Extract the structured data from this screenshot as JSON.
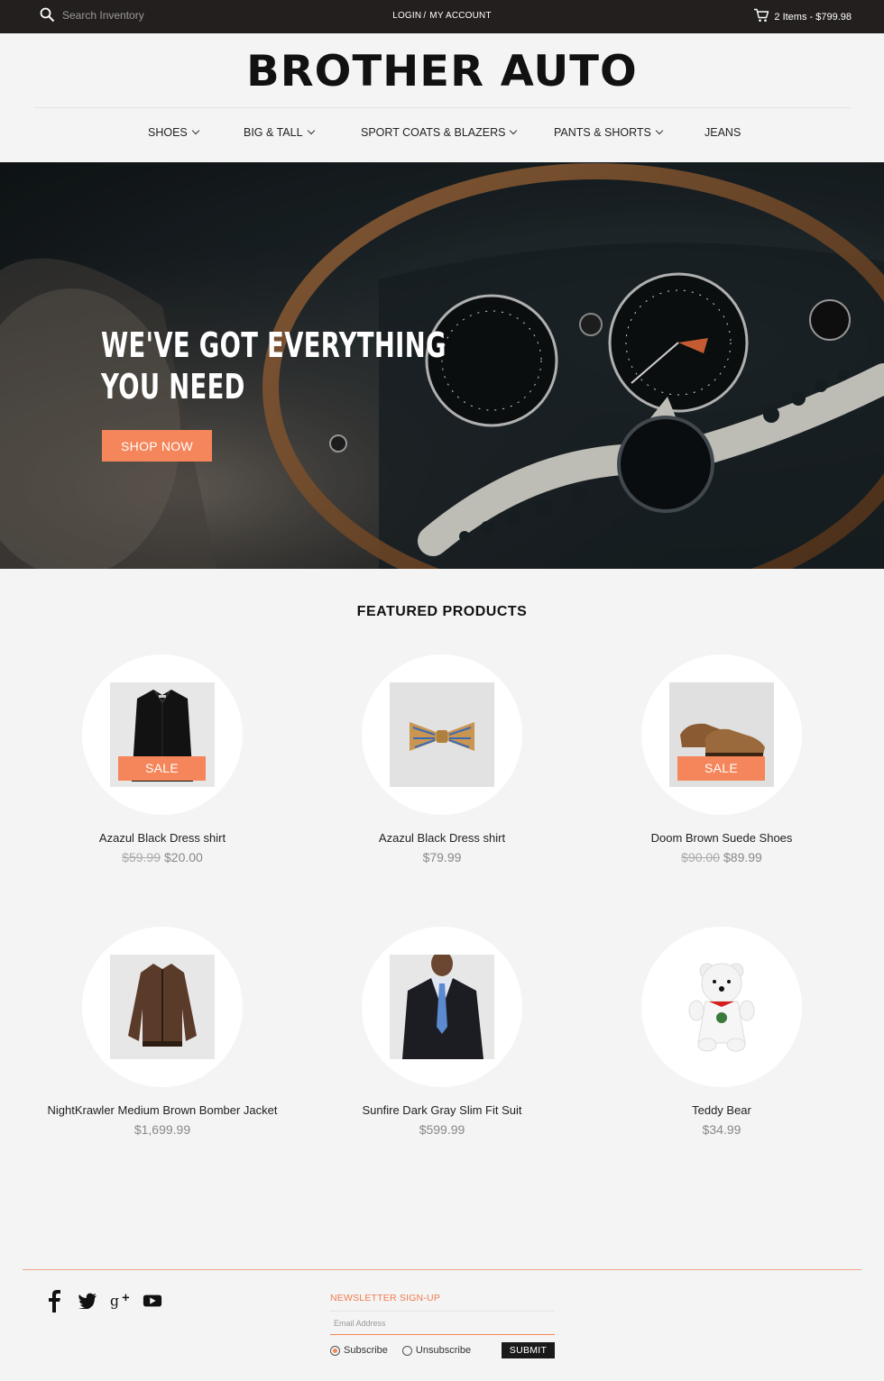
{
  "topbar": {
    "search_placeholder": "Search Inventory",
    "login": "LOGIN",
    "separator": "/",
    "my_account": "MY ACCOUNT",
    "cart": "2 Items - $799.98"
  },
  "header": {
    "brand": "BROTHER AUTO"
  },
  "nav": [
    {
      "label": "SHOES",
      "dropdown": true
    },
    {
      "label": "BIG & TALL",
      "dropdown": true
    },
    {
      "label": "SPORT COATS & BLAZERS",
      "dropdown": true
    },
    {
      "label": "PANTS & SHORTS",
      "dropdown": true
    },
    {
      "label": "JEANS",
      "dropdown": false
    }
  ],
  "hero": {
    "line1": "WE'VE GOT EVERYTHING",
    "line2": "YOU NEED",
    "button": "SHOP NOW"
  },
  "featured": {
    "title": "FEATURED PRODUCTS",
    "products": [
      {
        "name": "Azazul Black Dress shirt",
        "old_price": "$59.99",
        "price": "$20.00",
        "sale": "SALE"
      },
      {
        "name": "Azazul Black Dress shirt",
        "old_price": "",
        "price": "$79.99",
        "sale": ""
      },
      {
        "name": "Doom Brown Suede Shoes",
        "old_price": "$90.00",
        "price": "$89.99",
        "sale": "SALE"
      },
      {
        "name": "NightKrawler Medium Brown Bomber Jacket",
        "old_price": "",
        "price": "$1,699.99",
        "sale": ""
      },
      {
        "name": "Sunfire Dark Gray Slim Fit Suit",
        "old_price": "",
        "price": "$599.99",
        "sale": ""
      },
      {
        "name": "Teddy Bear",
        "old_price": "",
        "price": "$34.99",
        "sale": ""
      }
    ]
  },
  "footer": {
    "social": [
      "facebook-icon",
      "twitter-icon",
      "google-plus-icon",
      "youtube-icon"
    ],
    "newsletter_label": "NEWSLETTER SIGN-UP",
    "email_placeholder": "Email Address",
    "subscribe": "Subscribe",
    "unsubscribe": "Unsubscribe",
    "subscribe_selected": true,
    "submit": "SUBMIT"
  },
  "colors": {
    "accent": "#f5855a",
    "topbar": "#241f1f",
    "background": "#f4f4f4"
  }
}
